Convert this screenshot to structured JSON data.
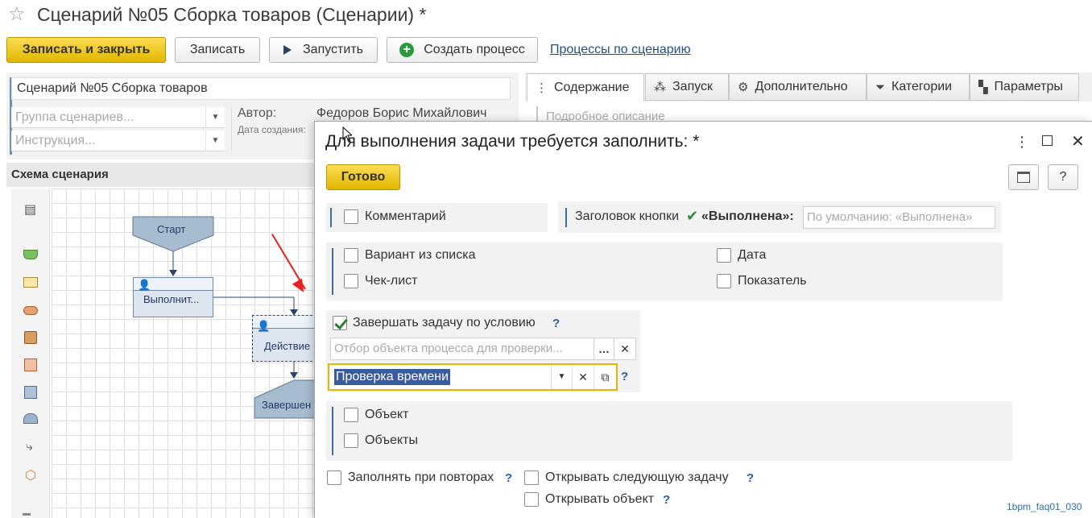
{
  "window": {
    "title": "Сценарий №05 Сборка товаров (Сценарии) *"
  },
  "toolbar": {
    "save_close": "Записать и закрыть",
    "save": "Записать",
    "run": "Запустить",
    "create_process": "Создать процесс",
    "processes_link": "Процессы по сценарию"
  },
  "form": {
    "name": "Сценарий №05 Сборка товаров",
    "group_placeholder": "Группа сценариев...",
    "instruction_placeholder": "Инструкция...",
    "author_label": "Автор:",
    "author_value": "Федоров Борис Михайлович",
    "date_label": "Дата создания:"
  },
  "tabs": [
    {
      "label": "Содержание",
      "icon": "tree-icon",
      "active": true
    },
    {
      "label": "Запуск",
      "icon": "wand-icon"
    },
    {
      "label": "Дополнительно",
      "icon": "gear-icon"
    },
    {
      "label": "Категории",
      "icon": "filter-icon"
    },
    {
      "label": "Параметры",
      "icon": "blocks-icon"
    }
  ],
  "content": {
    "description_placeholder": "Подробное описание"
  },
  "scheme": {
    "title": "Схема сценария",
    "nodes": {
      "start": "Старт",
      "executor": "Выполнит...",
      "action": "Действие",
      "finish": "Завершен"
    }
  },
  "dialog": {
    "title": "Для выполнения задачи требуется заполнить: *",
    "ready": "Готово",
    "help": "?",
    "comment": "Комментарий",
    "button_caption_label": "Заголовок кнопки",
    "button_caption_value": "«Выполнена»:",
    "button_caption_placeholder": "По умолчанию: «Выполнена»",
    "variant_list": "Вариант из списка",
    "date": "Дата",
    "checklist": "Чек-лист",
    "indicator": "Показатель",
    "finish_condition": "Завершать задачу по условию",
    "filter_placeholder": "Отбор объекта процесса для проверки...",
    "condition_value": "Проверка времени",
    "object": "Объект",
    "objects": "Объекты",
    "fill_on_repeat": "Заполнять при повторах",
    "open_next_task": "Открывать следующую задачу",
    "open_object": "Открывать объект",
    "q": "?"
  },
  "footer": {
    "id": "1bpm_faq01_030"
  }
}
